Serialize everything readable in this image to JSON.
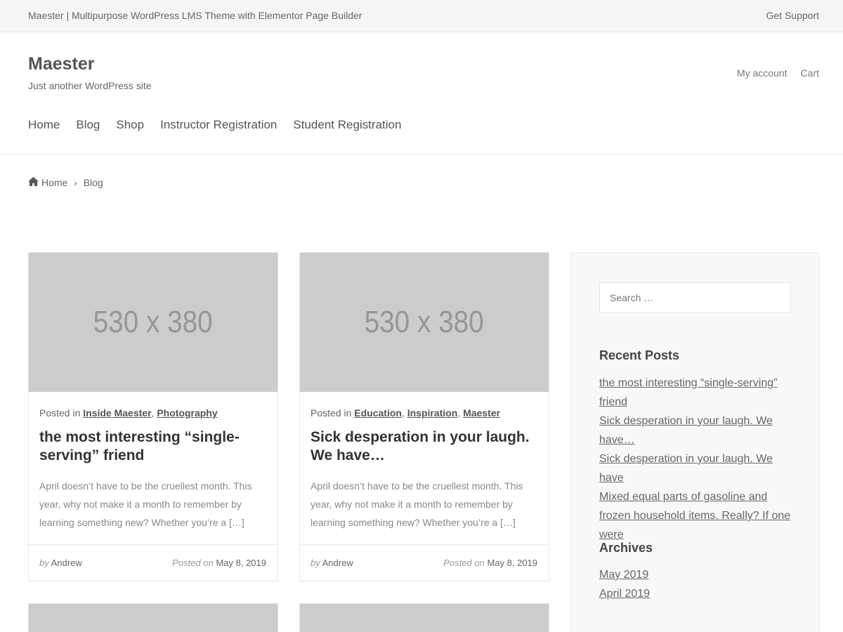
{
  "topbar": {
    "site_full_title": "Maester | Multipurpose WordPress LMS Theme with Elementor Page Builder",
    "support_link": "Get Support"
  },
  "header": {
    "site_title": "Maester",
    "tagline": "Just another WordPress site",
    "my_account": "My account",
    "cart": "Cart"
  },
  "nav": {
    "items": [
      {
        "label": "Home"
      },
      {
        "label": "Blog"
      },
      {
        "label": "Shop"
      },
      {
        "label": "Instructor Registration"
      },
      {
        "label": "Student Registration"
      }
    ]
  },
  "breadcrumb": {
    "home_icon": "home-icon",
    "home": "Home",
    "separator": "›",
    "current": "Blog"
  },
  "posts": [
    {
      "thumb_text": "530 x 380",
      "posted_in": "Posted in",
      "categories": [
        "Inside Maester",
        "Photography"
      ],
      "title": "the most interesting “single-serving” friend",
      "excerpt": "April doesn’t have to be the cruellest month. This year, why not make it a month to remember by learning something new? Whether you’re a […]",
      "by": "by",
      "author": "Andrew",
      "posted_on": "Posted on",
      "date": "May 8, 2019"
    },
    {
      "thumb_text": "530 x 380",
      "posted_in": "Posted in",
      "categories": [
        "Education",
        "Inspiration",
        "Maester"
      ],
      "title": "Sick desperation in your laugh. We have…",
      "excerpt": "April doesn’t have to be the cruellest month. This year, why not make it a month to remember by learning something new? Whether you’re a […]",
      "by": "by",
      "author": "Andrew",
      "posted_on": "Posted on",
      "date": "May 8, 2019"
    }
  ],
  "sidebar": {
    "search_placeholder": "Search …",
    "recent_posts_title": "Recent Posts",
    "recent_posts": [
      "the most interesting “single-serving” friend",
      "Sick desperation in your laugh. We have…",
      "Sick desperation in your laugh. We have",
      "Mixed equal parts of gasoline and frozen household items. Really? If one were"
    ],
    "archives_title": "Archives",
    "archives": [
      "May 2019",
      "April 2019"
    ]
  }
}
